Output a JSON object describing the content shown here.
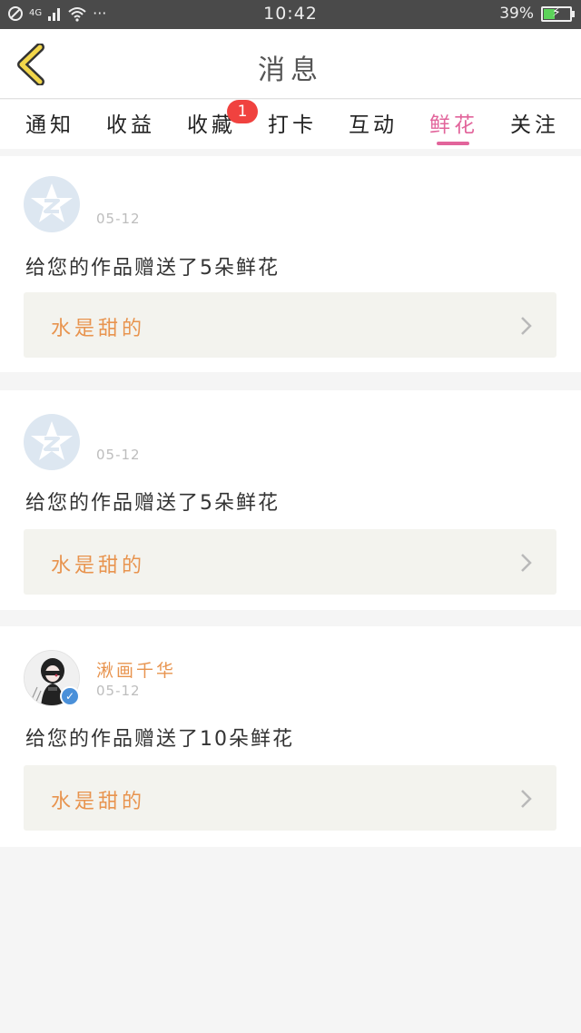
{
  "status_bar": {
    "network": "4G",
    "time": "10:42",
    "battery_percent": "39%",
    "battery_level": 0.39,
    "more": "···"
  },
  "header": {
    "title": "消息",
    "back_icon": "chevron-left-icon"
  },
  "tabs": [
    {
      "label": "通知",
      "active": false
    },
    {
      "label": "收益",
      "active": false
    },
    {
      "label": "收藏",
      "active": false,
      "badge": "1"
    },
    {
      "label": "打卡",
      "active": false
    },
    {
      "label": "互动",
      "active": false
    },
    {
      "label": "鲜花",
      "active": true
    },
    {
      "label": "关注",
      "active": false
    }
  ],
  "messages": [
    {
      "sender_name": "",
      "avatar": "default-avatar-icon",
      "date": "05-12",
      "text": "给您的作品赠送了5朵鲜花",
      "work_title": "水是甜的"
    },
    {
      "sender_name": "",
      "avatar": "default-avatar-icon",
      "date": "05-12",
      "text": "给您的作品赠送了5朵鲜花",
      "work_title": "水是甜的"
    },
    {
      "sender_name": "湫画千华",
      "avatar": "user-photo-avatar",
      "verified": true,
      "date": "05-12",
      "text": "给您的作品赠送了10朵鲜花",
      "work_title": "水是甜的"
    }
  ],
  "colors": {
    "accent_pink": "#e2649b",
    "name_orange": "#e8944f",
    "badge_red": "#f0423f",
    "verified_blue": "#4a90d9",
    "back_yellow": "#f2d64a"
  }
}
